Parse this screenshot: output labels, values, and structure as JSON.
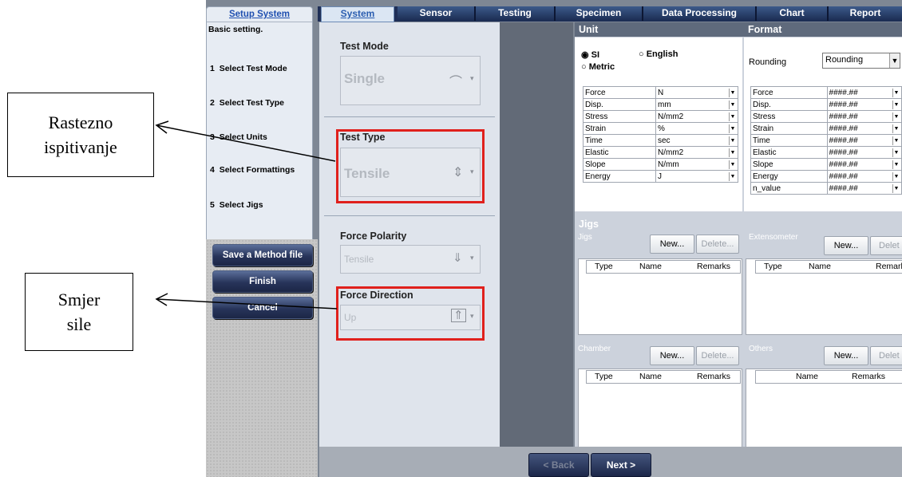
{
  "callouts": {
    "tensile": {
      "line1": "Rastezno",
      "line2": "ispitivanje"
    },
    "direction": {
      "line1": "Smjer",
      "line2": "sile"
    }
  },
  "tabs": [
    "System",
    "Sensor",
    "Testing",
    "Specimen",
    "Data Processing",
    "Chart",
    "Report"
  ],
  "sidebar": {
    "title": "Setup System",
    "subtitle": "Basic setting.",
    "steps": [
      {
        "num": "1",
        "label": "Select Test Mode"
      },
      {
        "num": "2",
        "label": "Select Test Type"
      },
      {
        "num": "3",
        "label": "Select Units"
      },
      {
        "num": "4",
        "label": "Select Formattings"
      },
      {
        "num": "5",
        "label": "Select Jigs"
      }
    ],
    "buttons": {
      "save": "Save a Method file",
      "finish": "Finish",
      "cancel": "Cancel"
    }
  },
  "settings": {
    "test_mode": {
      "label": "Test Mode",
      "value": "Single"
    },
    "test_type": {
      "label": "Test Type",
      "value": "Tensile"
    },
    "force_polarity": {
      "label": "Force Polarity",
      "value": "Tensile"
    },
    "force_direction": {
      "label": "Force Direction",
      "value": "Up"
    }
  },
  "unit": {
    "title": "Unit",
    "si": "SI",
    "english": "English",
    "metric": "Metric",
    "rows": [
      {
        "name": "Force",
        "value": "N"
      },
      {
        "name": "Disp.",
        "value": "mm"
      },
      {
        "name": "Stress",
        "value": "N/mm2"
      },
      {
        "name": "Strain",
        "value": "%"
      },
      {
        "name": "Time",
        "value": "sec"
      },
      {
        "name": "Elastic",
        "value": "N/mm2"
      },
      {
        "name": "Slope",
        "value": "N/mm"
      },
      {
        "name": "Energy",
        "value": "J"
      }
    ]
  },
  "format": {
    "title": "Format",
    "rounding_label": "Rounding",
    "rounding_value": "Rounding",
    "rows": [
      {
        "name": "Force",
        "value": "####.##"
      },
      {
        "name": "Disp.",
        "value": "####.##"
      },
      {
        "name": "Stress",
        "value": "####.##"
      },
      {
        "name": "Strain",
        "value": "####.##"
      },
      {
        "name": "Time",
        "value": "####.##"
      },
      {
        "name": "Elastic",
        "value": "####.##"
      },
      {
        "name": "Slope",
        "value": "####.##"
      },
      {
        "name": "Energy",
        "value": "####.##"
      },
      {
        "name": "n_value",
        "value": "####.##"
      }
    ]
  },
  "jigs": {
    "title": "Jigs",
    "jigs_label": "Jigs",
    "extensometer_label": "Extensometer",
    "chamber_label": "Chamber",
    "others_label": "Others",
    "new_label": "New...",
    "delete_label": "Delete...",
    "delete_cut": "Delet",
    "col_type": "Type",
    "col_name": "Name",
    "col_remarks": "Remarks",
    "col_remarks_cut": "Remarks"
  },
  "footer": {
    "back": "< Back",
    "next": "Next >"
  }
}
